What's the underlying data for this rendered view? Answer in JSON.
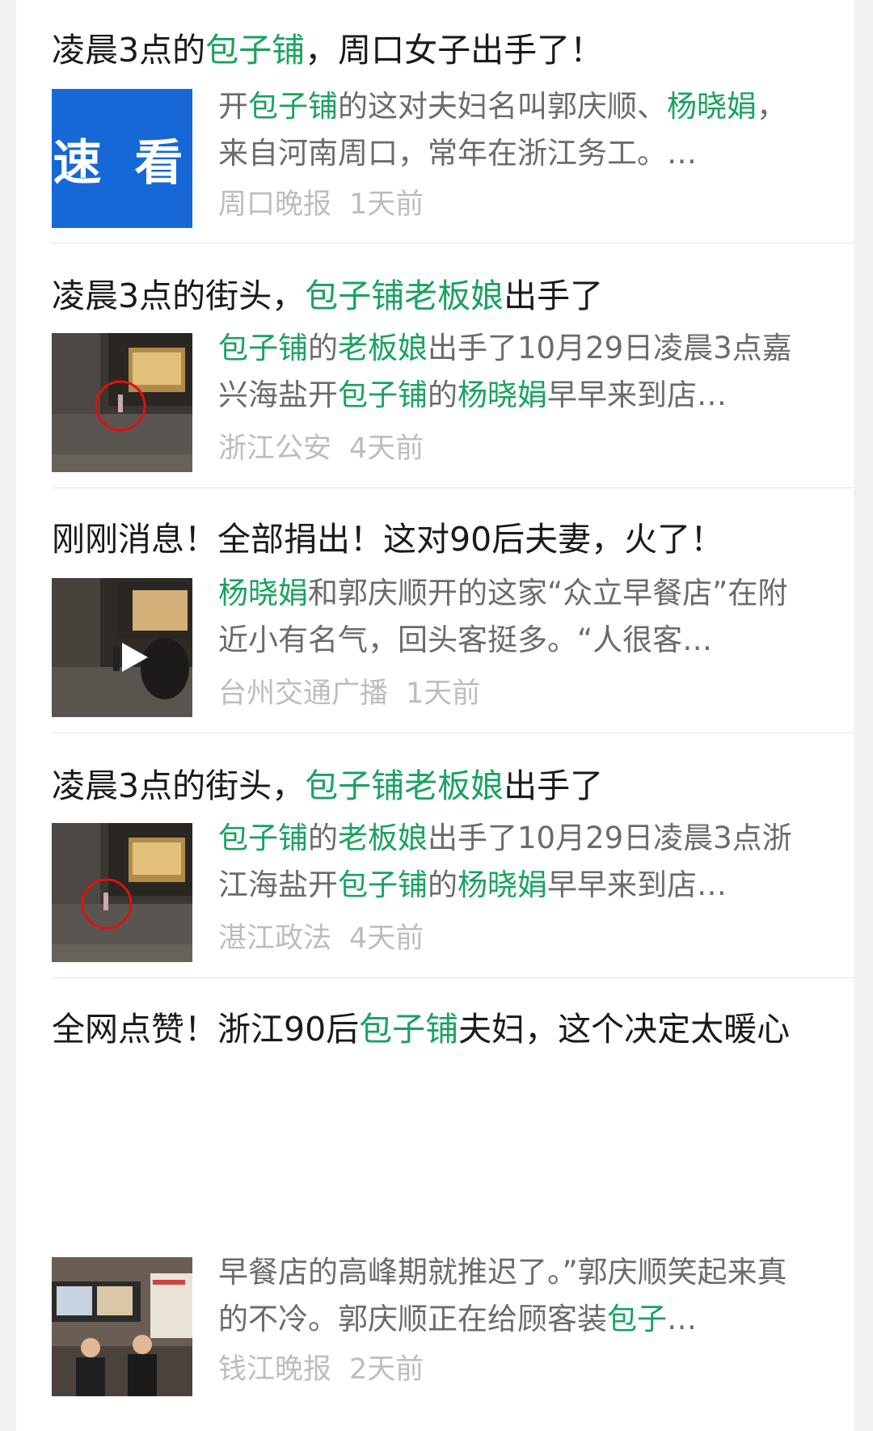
{
  "articles": [
    {
      "title_parts": [
        "凌晨3点的",
        "包子铺",
        "，周口女子出手了！"
      ],
      "summary_parts": [
        "开",
        "包子铺",
        "的这对夫妇名叫郭庆顺、",
        "杨晓娟",
        "，来自河南周口，常年在浙江务工。…"
      ],
      "source": "周口晚报",
      "time": "1天前",
      "thumb_text": "速 看"
    },
    {
      "title_parts": [
        "凌晨3点的街头，",
        "包子铺老板娘",
        "出手了"
      ],
      "summary_parts": [
        "包子铺",
        "的",
        "老板娘",
        "出手了10月29日凌晨3点嘉兴海盐开",
        "包子铺",
        "的",
        "杨晓娟",
        "早早来到店…"
      ],
      "source": "浙江公安",
      "time": "4天前"
    },
    {
      "title_parts": [
        "刚刚消息！全部捐出！这对90后夫妻，火了！"
      ],
      "summary_parts": [
        "杨晓娟",
        "和郭庆顺开的这家“众立早餐店”在附近小有名气，回头客挺多。“人很客…"
      ],
      "source": "台州交通广播",
      "time": "1天前"
    },
    {
      "title_parts": [
        "凌晨3点的街头，",
        "包子铺老板娘",
        "出手了"
      ],
      "summary_parts": [
        "包子铺",
        "的",
        "老板娘",
        "出手了10月29日凌晨3点浙江海盐开",
        "包子铺",
        "的",
        "杨晓娟",
        "早早来到店…"
      ],
      "source": "湛江政法",
      "time": "4天前"
    },
    {
      "title_parts": [
        "全网点赞！浙江90后",
        "包子铺",
        "夫妇，这个决定太暖心"
      ],
      "summary_parts": [
        "早餐店的高峰期就推迟了。”郭庆顺笑起来真的不冷。郭庆顺正在给顾客装",
        "包子",
        "…"
      ],
      "source": "钱江晚报",
      "time": "2天前"
    }
  ],
  "colors": {
    "highlight": "#1aa260",
    "title": "#1a1a1a",
    "summary": "#6b6b6b",
    "meta": "#bdbdbd"
  }
}
